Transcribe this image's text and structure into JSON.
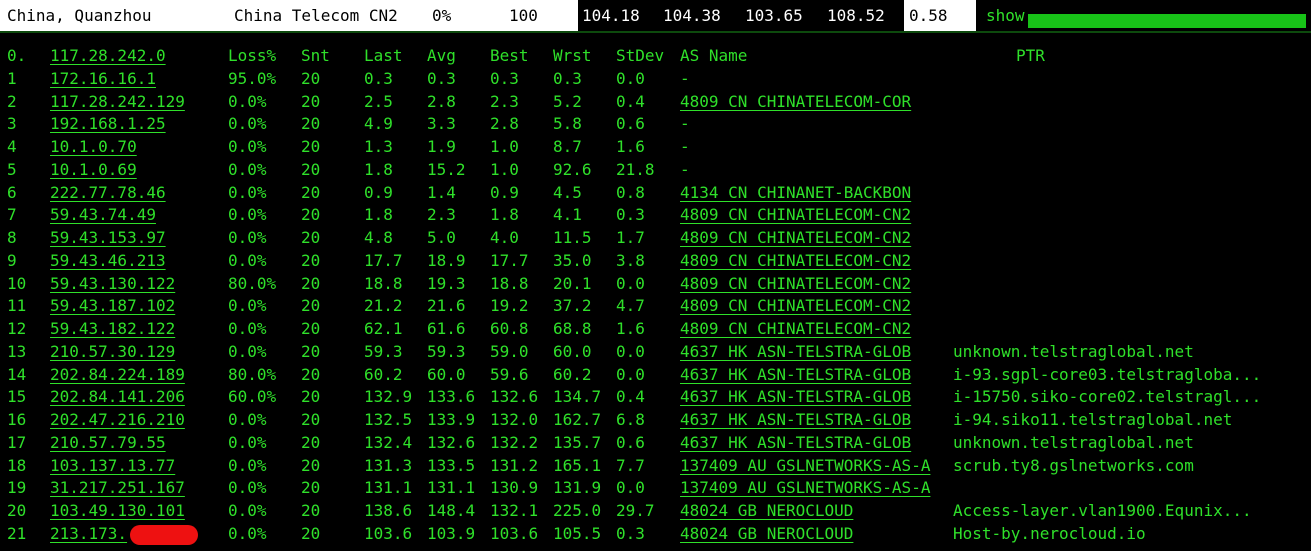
{
  "summary": {
    "location": "China, Quanzhou",
    "isp": "China Telecom CN2",
    "loss": "0%",
    "sent": "100",
    "last": "104.18",
    "avg": "104.38",
    "best": "103.65",
    "worst": "108.52",
    "stdev": "0.58",
    "show_label": "show",
    "progress": 1.0
  },
  "headers": {
    "hop": "0.",
    "host": "117.28.242.0",
    "loss": "Loss%",
    "snt": "Snt",
    "last": "Last",
    "avg": "Avg",
    "best": "Best",
    "wrst": "Wrst",
    "stdev": "StDev",
    "as": "AS Name",
    "ptr": "PTR"
  },
  "rows": [
    {
      "hop": "1",
      "host": "172.16.16.1",
      "loss": "95.0%",
      "snt": "20",
      "last": "0.3",
      "avg": "0.3",
      "best": "0.3",
      "wrst": "0.3",
      "stdev": "0.0",
      "as": "-",
      "ptr": ""
    },
    {
      "hop": "2",
      "host": "117.28.242.129",
      "loss": "0.0%",
      "snt": "20",
      "last": "2.5",
      "avg": "2.8",
      "best": "2.3",
      "wrst": "5.2",
      "stdev": "0.4",
      "as": "4809  CN CHINATELECOM-COR",
      "ptr": ""
    },
    {
      "hop": "3",
      "host": "192.168.1.25",
      "loss": "0.0%",
      "snt": "20",
      "last": "4.9",
      "avg": "3.3",
      "best": "2.8",
      "wrst": "5.8",
      "stdev": "0.6",
      "as": "-",
      "ptr": ""
    },
    {
      "hop": "4",
      "host": "10.1.0.70",
      "loss": "0.0%",
      "snt": "20",
      "last": "1.3",
      "avg": "1.9",
      "best": "1.0",
      "wrst": "8.7",
      "stdev": "1.6",
      "as": "-",
      "ptr": ""
    },
    {
      "hop": "5",
      "host": "10.1.0.69",
      "loss": "0.0%",
      "snt": "20",
      "last": "1.8",
      "avg": "15.2",
      "best": "1.0",
      "wrst": "92.6",
      "stdev": "21.8",
      "as": "-",
      "ptr": ""
    },
    {
      "hop": "6",
      "host": "222.77.78.46",
      "loss": "0.0%",
      "snt": "20",
      "last": "0.9",
      "avg": "1.4",
      "best": "0.9",
      "wrst": "4.5",
      "stdev": "0.8",
      "as": "4134  CN CHINANET-BACKBON",
      "ptr": ""
    },
    {
      "hop": "7",
      "host": "59.43.74.49",
      "loss": "0.0%",
      "snt": "20",
      "last": "1.8",
      "avg": "2.3",
      "best": "1.8",
      "wrst": "4.1",
      "stdev": "0.3",
      "as": "4809  CN CHINATELECOM-CN2",
      "ptr": ""
    },
    {
      "hop": "8",
      "host": "59.43.153.97",
      "loss": "0.0%",
      "snt": "20",
      "last": "4.8",
      "avg": "5.0",
      "best": "4.0",
      "wrst": "11.5",
      "stdev": "1.7",
      "as": "4809  CN CHINATELECOM-CN2",
      "ptr": ""
    },
    {
      "hop": "9",
      "host": "59.43.46.213",
      "loss": "0.0%",
      "snt": "20",
      "last": "17.7",
      "avg": "18.9",
      "best": "17.7",
      "wrst": "35.0",
      "stdev": "3.8",
      "as": "4809  CN CHINATELECOM-CN2",
      "ptr": ""
    },
    {
      "hop": "10",
      "host": "59.43.130.122",
      "loss": "80.0%",
      "snt": "20",
      "last": "18.8",
      "avg": "19.3",
      "best": "18.8",
      "wrst": "20.1",
      "stdev": "0.0",
      "as": "4809  CN CHINATELECOM-CN2",
      "ptr": ""
    },
    {
      "hop": "11",
      "host": "59.43.187.102",
      "loss": "0.0%",
      "snt": "20",
      "last": "21.2",
      "avg": "21.6",
      "best": "19.2",
      "wrst": "37.2",
      "stdev": "4.7",
      "as": "4809  CN CHINATELECOM-CN2",
      "ptr": ""
    },
    {
      "hop": "12",
      "host": "59.43.182.122",
      "loss": "0.0%",
      "snt": "20",
      "last": "62.1",
      "avg": "61.6",
      "best": "60.8",
      "wrst": "68.8",
      "stdev": "1.6",
      "as": "4809  CN CHINATELECOM-CN2",
      "ptr": ""
    },
    {
      "hop": "13",
      "host": "210.57.30.129",
      "loss": "0.0%",
      "snt": "20",
      "last": "59.3",
      "avg": "59.3",
      "best": "59.0",
      "wrst": "60.0",
      "stdev": "0.0",
      "as": "4637  HK ASN-TELSTRA-GLOB",
      "ptr": "unknown.telstraglobal.net"
    },
    {
      "hop": "14",
      "host": "202.84.224.189",
      "loss": "80.0%",
      "snt": "20",
      "last": "60.2",
      "avg": "60.0",
      "best": "59.6",
      "wrst": "60.2",
      "stdev": "0.0",
      "as": "4637  HK ASN-TELSTRA-GLOB",
      "ptr": "i-93.sgpl-core03.telstragloba..."
    },
    {
      "hop": "15",
      "host": "202.84.141.206",
      "loss": "60.0%",
      "snt": "20",
      "last": "132.9",
      "avg": "133.6",
      "best": "132.6",
      "wrst": "134.7",
      "stdev": "0.4",
      "as": "4637  HK ASN-TELSTRA-GLOB",
      "ptr": "i-15750.siko-core02.telstragl..."
    },
    {
      "hop": "16",
      "host": "202.47.216.210",
      "loss": "0.0%",
      "snt": "20",
      "last": "132.5",
      "avg": "133.9",
      "best": "132.0",
      "wrst": "162.7",
      "stdev": "6.8",
      "as": "4637  HK ASN-TELSTRA-GLOB",
      "ptr": "i-94.siko11.telstraglobal.net"
    },
    {
      "hop": "17",
      "host": "210.57.79.55",
      "loss": "0.0%",
      "snt": "20",
      "last": "132.4",
      "avg": "132.6",
      "best": "132.2",
      "wrst": "135.7",
      "stdev": "0.6",
      "as": "4637  HK ASN-TELSTRA-GLOB",
      "ptr": "unknown.telstraglobal.net"
    },
    {
      "hop": "18",
      "host": "103.137.13.77",
      "loss": "0.0%",
      "snt": "20",
      "last": "131.3",
      "avg": "133.5",
      "best": "131.2",
      "wrst": "165.1",
      "stdev": "7.7",
      "as": "137409 AU GSLNETWORKS-AS-A",
      "ptr": "scrub.ty8.gslnetworks.com"
    },
    {
      "hop": "19",
      "host": "31.217.251.167",
      "loss": "0.0%",
      "snt": "20",
      "last": "131.1",
      "avg": "131.1",
      "best": "130.9",
      "wrst": "131.9",
      "stdev": "0.0",
      "as": "137409 AU GSLNETWORKS-AS-A",
      "ptr": ""
    },
    {
      "hop": "20",
      "host": "103.49.130.101",
      "loss": "0.0%",
      "snt": "20",
      "last": "138.6",
      "avg": "148.4",
      "best": "132.1",
      "wrst": "225.0",
      "stdev": "29.7",
      "as": "48024 GB NEROCLOUD",
      "ptr": "Access-layer.vlan1900.Equnix..."
    },
    {
      "hop": "21",
      "host": "213.173.",
      "loss": "0.0%",
      "snt": "20",
      "last": "103.6",
      "avg": "103.9",
      "best": "103.6",
      "wrst": "105.5",
      "stdev": "0.3",
      "as": "48024 GB NEROCLOUD",
      "ptr": "Host-by.nerocloud.io"
    }
  ]
}
